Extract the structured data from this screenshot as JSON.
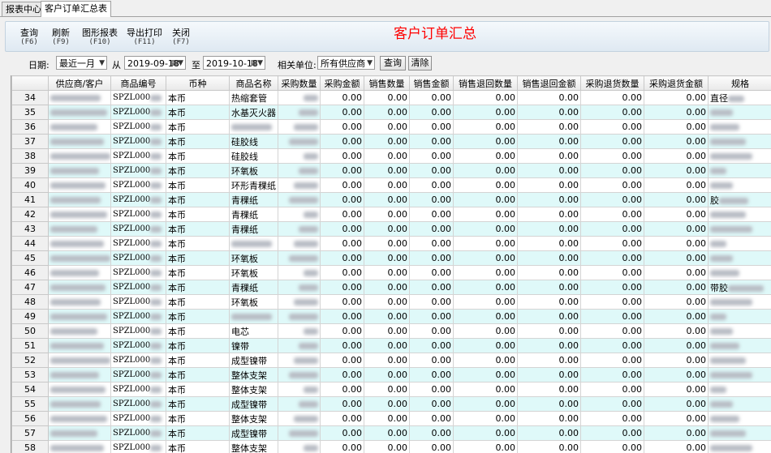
{
  "tabs": [
    {
      "label": "报表中心",
      "active": false
    },
    {
      "label": "客户订单汇总表",
      "active": true
    }
  ],
  "toolbar": [
    {
      "label": "查询",
      "key": "(F6)"
    },
    {
      "label": "刷新",
      "key": "(F9)"
    },
    {
      "label": "图形报表",
      "key": "(F10)"
    },
    {
      "label": "导出打印",
      "key": "(F11)"
    },
    {
      "label": "关闭",
      "key": "(F7)"
    }
  ],
  "title": "客户订单汇总",
  "filter": {
    "date_label": "日期:",
    "period": "最近一月",
    "from_label": "从",
    "from_date": "2019-09-18",
    "to_label": "至",
    "to_date": "2019-10-18",
    "unit_label": "相关单位:",
    "unit": "所有供应商",
    "query_button": "查询",
    "clear_button": "清除"
  },
  "columns": [
    "",
    "供应商/客户",
    "商品编号",
    "币种",
    "商品名称",
    "采购数量",
    "采购金额",
    "销售数量",
    "销售金额",
    "销售退回数量",
    "销售退回金额",
    "采购退货数量",
    "采购退货金额",
    "规格"
  ],
  "rows": [
    {
      "n": "34",
      "code": "SPZL000",
      "cur": "本币",
      "name": "热缩套管",
      "spec": "直径"
    },
    {
      "n": "35",
      "code": "SPZL000",
      "cur": "本币",
      "name": "水基灭火器",
      "spec": ""
    },
    {
      "n": "36",
      "code": "SPZL000",
      "cur": "本币",
      "name": "",
      "spec": ""
    },
    {
      "n": "37",
      "code": "SPZL000",
      "cur": "本币",
      "name": "硅胶线",
      "spec": ""
    },
    {
      "n": "38",
      "code": "SPZL000",
      "cur": "本币",
      "name": "硅胶线",
      "spec": ""
    },
    {
      "n": "39",
      "code": "SPZL000",
      "cur": "本币",
      "name": "环氧板",
      "spec": ""
    },
    {
      "n": "40",
      "code": "SPZL000",
      "cur": "本币",
      "name": "环形青稞纸",
      "spec": ""
    },
    {
      "n": "41",
      "code": "SPZL000",
      "cur": "本币",
      "name": "青稞纸",
      "spec": "胶"
    },
    {
      "n": "42",
      "code": "SPZL000",
      "cur": "本币",
      "name": "青稞纸",
      "spec": ""
    },
    {
      "n": "43",
      "code": "SPZL000",
      "cur": "本币",
      "name": "青稞纸",
      "spec": ""
    },
    {
      "n": "44",
      "code": "SPZL000",
      "cur": "本币",
      "name": "",
      "spec": ""
    },
    {
      "n": "45",
      "code": "SPZL000",
      "cur": "本币",
      "name": "环氧板",
      "spec": ""
    },
    {
      "n": "46",
      "code": "SPZL000",
      "cur": "本币",
      "name": "环氧板",
      "spec": ""
    },
    {
      "n": "47",
      "code": "SPZL000",
      "cur": "本币",
      "name": "青稞纸",
      "spec": "带胶"
    },
    {
      "n": "48",
      "code": "SPZL000",
      "cur": "本币",
      "name": "环氧板",
      "spec": ""
    },
    {
      "n": "49",
      "code": "SPZL000",
      "cur": "本币",
      "name": "",
      "spec": ""
    },
    {
      "n": "50",
      "code": "SPZL000",
      "cur": "本币",
      "name": "电芯",
      "spec": ""
    },
    {
      "n": "51",
      "code": "SPZL000",
      "cur": "本币",
      "name": "镍带",
      "spec": ""
    },
    {
      "n": "52",
      "code": "SPZL000",
      "cur": "本币",
      "name": "成型镍带",
      "spec": ""
    },
    {
      "n": "53",
      "code": "SPZL000",
      "cur": "本币",
      "name": "整体支架",
      "spec": ""
    },
    {
      "n": "54",
      "code": "SPZL000",
      "cur": "本币",
      "name": "整体支架",
      "spec": ""
    },
    {
      "n": "55",
      "code": "SPZL000",
      "cur": "本币",
      "name": "成型镍带",
      "spec": ""
    },
    {
      "n": "56",
      "code": "SPZL000",
      "cur": "本币",
      "name": "整体支架",
      "spec": ""
    },
    {
      "n": "57",
      "code": "SPZL000",
      "cur": "本币",
      "name": "成型镍带",
      "spec": ""
    },
    {
      "n": "58",
      "code": "SPZL000",
      "cur": "本币",
      "name": "整体支架",
      "spec": ""
    }
  ],
  "zero": "0.00"
}
